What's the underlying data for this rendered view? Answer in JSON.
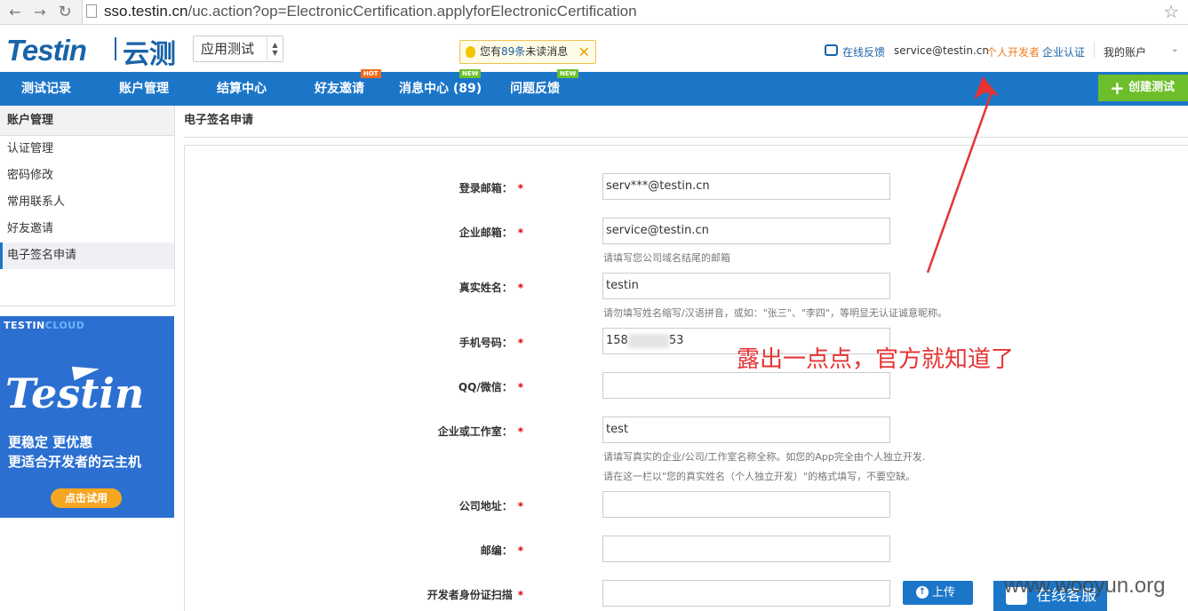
{
  "browser": {
    "url_domain": "sso.testin.cn",
    "url_path": "/uc.action?op=ElectronicCertification.applyforElectronicCertification"
  },
  "header": {
    "logo": "Testin",
    "logo_cn": "云测",
    "app_select": "应用测试",
    "notice_prefix": "您有",
    "notice_count": "89条",
    "notice_suffix": "未读消息",
    "feedback": "在线反馈",
    "email": "service@testin.cn",
    "role": "个人开发者",
    "cert": "企业认证",
    "account": "我的账户"
  },
  "nav": {
    "items": [
      {
        "label": "测试记录"
      },
      {
        "label": "账户管理"
      },
      {
        "label": "结算中心"
      },
      {
        "label": "好友邀请",
        "badge": "HOT"
      },
      {
        "label": "消息中心 (89)",
        "badge": "NEW"
      },
      {
        "label": "问题反馈",
        "badge": "NEW"
      }
    ],
    "create": "创建测试"
  },
  "sidebar": {
    "title": "账户管理",
    "items": [
      "认证管理",
      "密码修改",
      "常用联系人",
      "好友邀请",
      "电子签名申请"
    ]
  },
  "ad": {
    "brand_a": "TESTIN",
    "brand_b": "CLOUD",
    "script": "Testin",
    "line1": "更稳定  更优惠",
    "line2": "更适合开发者的云主机",
    "button": "点击试用"
  },
  "main": {
    "title": "电子签名申请",
    "fields": {
      "login_email": {
        "label": "登录邮箱：",
        "value": "serv***@testin.cn"
      },
      "company_email": {
        "label": "企业邮箱：",
        "value": "service@testin.cn",
        "hint": "请填写您公司域名结尾的邮箱"
      },
      "real_name": {
        "label": "真实姓名：",
        "value": "testin",
        "hint": "请勿填写姓名缩写/汉语拼音，或如：\"张三\"、\"李四\"，等明显无认证诚意昵称。"
      },
      "phone": {
        "label": "手机号码：",
        "value_start": "158",
        "value_end": "53"
      },
      "qq": {
        "label": "QQ/微信：",
        "value": ""
      },
      "company": {
        "label": "企业或工作室：",
        "value": "test",
        "hint1": "请填写真实的企业/公司/工作室名称全称。如您的App完全由个人独立开发.",
        "hint2": "请在这一栏以\"您的真实姓名（个人独立开发）\"的格式填写，不要空缺。"
      },
      "address": {
        "label": "公司地址：",
        "value": ""
      },
      "zip": {
        "label": "邮编：",
        "value": ""
      },
      "id_scan": {
        "label": "开发者身份证扫描",
        "value": ""
      }
    },
    "required_mark": "*",
    "upload": "上传"
  },
  "annotation": "露出一点点，官方就知道了",
  "customer_service": "在线客服",
  "watermark": "www.wooyun.org",
  "colors": {
    "brand_blue": "#1c76c8",
    "create_green": "#6cbf2a",
    "annotation_red": "#e53333"
  }
}
